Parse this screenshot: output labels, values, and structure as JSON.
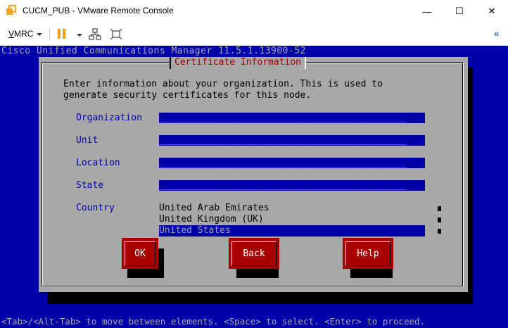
{
  "window": {
    "title": "CUCM_PUB - VMware Remote Console",
    "minimize_glyph": "—",
    "maximize_glyph": "☐",
    "close_glyph": "✕"
  },
  "toolbar": {
    "vmrc_first": "V",
    "vmrc_rest": "MRC",
    "collapse_glyph": "«"
  },
  "console": {
    "header": "Cisco Unified Communications Manager 11.5.1.13900-52",
    "footer": "<Tab>/<Alt-Tab> to move between elements. <Space> to select. <Enter> to proceed."
  },
  "dialog": {
    "title": "Certificate Information",
    "intro_line1": "Enter information about your organization. This is used to",
    "intro_line2": "generate security certificates for this node.",
    "fields": [
      {
        "label": "Organization",
        "value": "_____________________________________________"
      },
      {
        "label": "Unit",
        "value": "_____________________________________________"
      },
      {
        "label": "Location",
        "value": "_____________________________________________"
      },
      {
        "label": "State",
        "value": "_____________________________________________"
      }
    ],
    "country_label": "Country",
    "countries": [
      "United Arab Emirates",
      "United Kingdom (UK)",
      "United States"
    ],
    "selected_country": "United States",
    "buttons": {
      "ok": "OK",
      "back": "Back",
      "help": "Help"
    }
  },
  "colors": {
    "console_blue": "#0000a8",
    "dialog_gray": "#a8a8a8",
    "title_red": "#a80000",
    "button_red": "#a80000"
  },
  "icons": {
    "app": "vmware-logo-icon",
    "pause": "pause-icon",
    "network": "network-icon",
    "fit": "fit-screen-icon",
    "collapse": "double-chevron-left-icon"
  }
}
